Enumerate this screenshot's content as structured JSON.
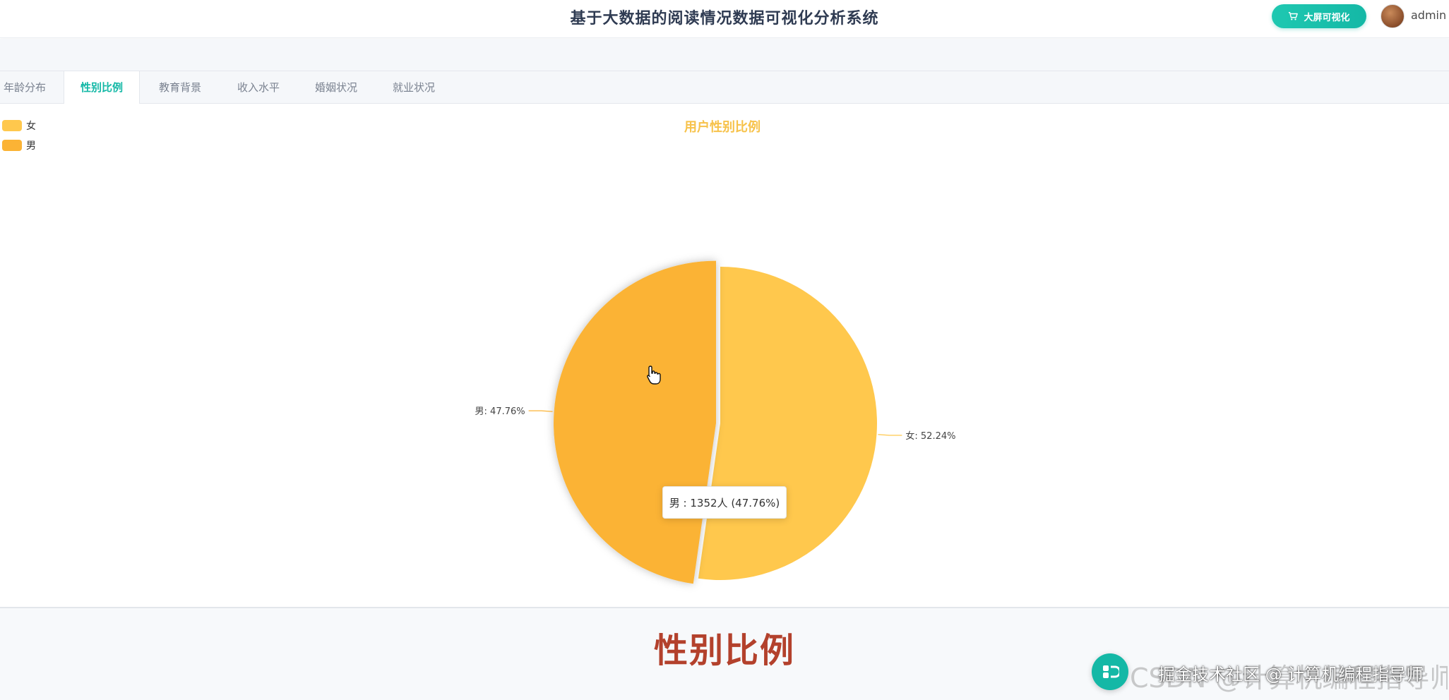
{
  "header": {
    "title": "基于大数据的阅读情况数据可视化分析系统",
    "big_screen_label": "大屏可视化",
    "username": "admin",
    "cart_icon": "cart-icon",
    "accent_color": "#14b8a6"
  },
  "tabs": [
    {
      "label": "年龄分布",
      "active": false
    },
    {
      "label": "性别比例",
      "active": true
    },
    {
      "label": "教育背景",
      "active": false
    },
    {
      "label": "收入水平",
      "active": false
    },
    {
      "label": "婚姻状况",
      "active": false
    },
    {
      "label": "就业状况",
      "active": false
    }
  ],
  "chart_data": {
    "type": "pie",
    "title": "用户性别比例",
    "title_color": "#f7c24a",
    "legend_position": "top-left",
    "slices": [
      {
        "name": "女",
        "percent": 52.24,
        "color": "#ffc84d",
        "label": "女: 52.24%"
      },
      {
        "name": "男",
        "percent": 47.76,
        "color": "#fbb335",
        "label": "男: 47.76%",
        "highlighted": true
      }
    ],
    "tooltip": "男 : 1352人 (47.76%)"
  },
  "footer": {
    "caption": "性别比例",
    "watermark": "CSDN @计算机编程指导师",
    "attribution": "掘金技术社区 @ 计算机编程指导师"
  }
}
